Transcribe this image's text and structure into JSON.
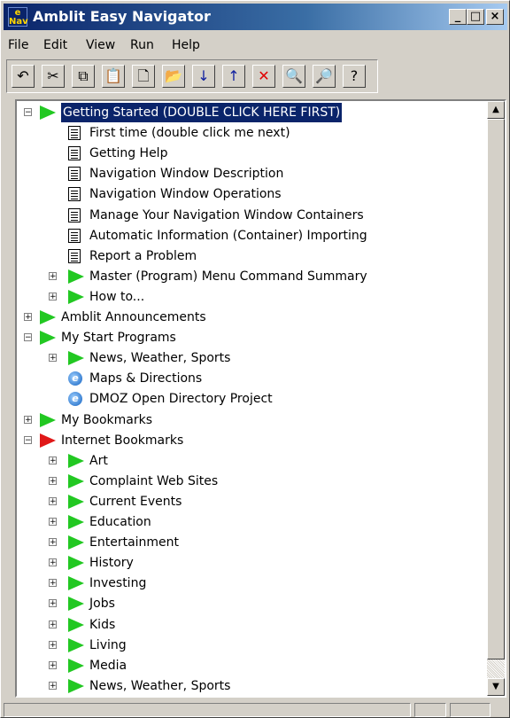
{
  "window": {
    "title": "Amblit Easy Navigator",
    "icon_text": "e Nav",
    "controls": {
      "minimize": "_",
      "maximize": "□",
      "close": "×"
    }
  },
  "menu": [
    "File",
    "Edit",
    "View",
    "Run",
    "Help"
  ],
  "toolbar": [
    {
      "name": "undo-icon",
      "glyph": "↶"
    },
    {
      "name": "cut-icon",
      "glyph": "✂"
    },
    {
      "name": "copy-icon",
      "glyph": "⧉"
    },
    {
      "name": "paste-icon",
      "glyph": "📋"
    },
    {
      "name": "new-icon",
      "glyph": "🗋"
    },
    {
      "name": "open-folder-icon",
      "glyph": "📂"
    },
    {
      "name": "move-down-icon",
      "glyph": "↓"
    },
    {
      "name": "move-up-icon",
      "glyph": "↑"
    },
    {
      "name": "delete-icon",
      "glyph": "✕"
    },
    {
      "name": "find-icon",
      "glyph": "🔍"
    },
    {
      "name": "find-next-icon",
      "glyph": "🔎"
    },
    {
      "name": "help-icon",
      "glyph": "?"
    }
  ],
  "tree": [
    {
      "label": "Getting Started (DOUBLE CLICK HERE FIRST)",
      "level": 0,
      "type": "folder",
      "expander": "minus",
      "selected": true
    },
    {
      "label": "First time (double click me next)",
      "level": 1,
      "type": "doc"
    },
    {
      "label": "Getting Help",
      "level": 1,
      "type": "doc"
    },
    {
      "label": "Navigation Window Description",
      "level": 1,
      "type": "doc"
    },
    {
      "label": "Navigation Window Operations",
      "level": 1,
      "type": "doc"
    },
    {
      "label": "Manage Your Navigation Window Containers",
      "level": 1,
      "type": "doc"
    },
    {
      "label": "Automatic Information (Container) Importing",
      "level": 1,
      "type": "doc"
    },
    {
      "label": "Report a Problem",
      "level": 1,
      "type": "doc"
    },
    {
      "label": "Master (Program) Menu Command Summary",
      "level": 1,
      "type": "folder",
      "expander": "plus"
    },
    {
      "label": "How to...",
      "level": 1,
      "type": "folder",
      "expander": "plus"
    },
    {
      "label": "Amblit Announcements",
      "level": 0,
      "type": "folder",
      "expander": "plus"
    },
    {
      "label": "My Start Programs",
      "level": 0,
      "type": "folder",
      "expander": "minus"
    },
    {
      "label": "News, Weather, Sports",
      "level": 1,
      "type": "folder",
      "expander": "plus"
    },
    {
      "label": "Maps & Directions",
      "level": 1,
      "type": "web"
    },
    {
      "label": "DMOZ Open Directory Project",
      "level": 1,
      "type": "web"
    },
    {
      "label": "My Bookmarks",
      "level": 0,
      "type": "folder",
      "expander": "plus"
    },
    {
      "label": "Internet Bookmarks",
      "level": 0,
      "type": "folder-red",
      "expander": "minus"
    },
    {
      "label": "Art",
      "level": 1,
      "type": "folder",
      "expander": "plus"
    },
    {
      "label": "Complaint Web Sites",
      "level": 1,
      "type": "folder",
      "expander": "plus"
    },
    {
      "label": "Current Events",
      "level": 1,
      "type": "folder",
      "expander": "plus"
    },
    {
      "label": "Education",
      "level": 1,
      "type": "folder",
      "expander": "plus"
    },
    {
      "label": "Entertainment",
      "level": 1,
      "type": "folder",
      "expander": "plus"
    },
    {
      "label": "History",
      "level": 1,
      "type": "folder",
      "expander": "plus"
    },
    {
      "label": "Investing",
      "level": 1,
      "type": "folder",
      "expander": "plus"
    },
    {
      "label": "Jobs",
      "level": 1,
      "type": "folder",
      "expander": "plus"
    },
    {
      "label": "Kids",
      "level": 1,
      "type": "folder",
      "expander": "plus"
    },
    {
      "label": "Living",
      "level": 1,
      "type": "folder",
      "expander": "plus"
    },
    {
      "label": "Media",
      "level": 1,
      "type": "folder",
      "expander": "plus"
    },
    {
      "label": "News, Weather, Sports",
      "level": 1,
      "type": "folder",
      "expander": "plus"
    }
  ],
  "colors": {
    "title_start": "#0a246a",
    "title_end": "#a6caf0",
    "flag_green": "#22c822",
    "flag_red": "#e01818",
    "selection": "#0a246a"
  }
}
